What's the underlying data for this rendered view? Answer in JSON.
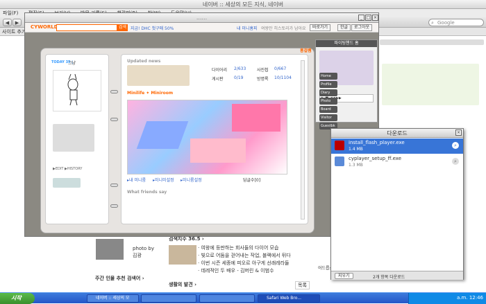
{
  "browser": {
    "title": "네이버 :: 세상의 모든 지식, 네이버",
    "menu": [
      "파일(F)",
      "편집(E)",
      "보기(V)",
      "방문 기록(S)",
      "책갈피(B)",
      "창(W)",
      "도움말(H)"
    ],
    "search_placeholder": "Google",
    "bookmark_label": "사이트 추가"
  },
  "cyworld": {
    "window_title": "......",
    "logo": "CYWORLD",
    "search_button": "검색",
    "ad_text": "지금! DHC 첫구매 50%",
    "links": [
      "내 미니홈피",
      "여왕만 히스토리가 남아요"
    ],
    "goto_label": "바로가기",
    "hangul_label": "한글",
    "logout_label": "로그아웃",
    "shop_label": "홍걸쌤",
    "left_page": {
      "today_label": "TODAY 35 |",
      "status_label": "그냥",
      "edit_history": "▶EDIT ▶HISTORY"
    },
    "right_page": {
      "updated_news": "Updated news",
      "stats": [
        {
          "label": "다이어리",
          "value": "2/633"
        },
        {
          "label": "사진첩",
          "value": "0/667"
        },
        {
          "label": "게시판",
          "value": "0/19"
        },
        {
          "label": "방명록",
          "value": "10/1104"
        }
      ],
      "minilife": "Minilife ✦ Miniroom",
      "room_links": [
        "▸내 미니룸",
        "▸미니미설정",
        "▸미니룸설정"
      ],
      "comment_label": "답글수[0]",
      "friends_say": "What friends say"
    },
    "bgm_title": "파이팅핸드 홈",
    "side_tabs": [
      "Home",
      "Profile",
      "Diary",
      "Photo",
      "Board",
      "Visitor",
      "Guestbk"
    ]
  },
  "downloads": {
    "title": "다운로드",
    "items": [
      {
        "name": "install_flash_player.exe",
        "size": "1.4 MB",
        "selected": true
      },
      {
        "name": "cyplayer_setup_ff.exe",
        "size": "1.3 MB",
        "selected": false
      }
    ],
    "clear_label": "지우기",
    "count_label": "2개 항목 다운로드"
  },
  "naver": {
    "news_title": "검색지수 36.5 ›",
    "news_items": [
      "· 여왕에 등판하는 회사들의 다이어 모습",
      "· 빛으로 어둠을 걷어내는 작업, 블랙에서 뒤다",
      "· 이번 시즌 세종에 피오르 아구게 선래레라들",
      "· 데레적인 두 배우 - 김머린 & 이범수"
    ],
    "photo_by": "photo by",
    "photo_author": "김광",
    "weekly_title": "주간 인물 추천 검색어 ›",
    "life_title": "생활의 발견 ›",
    "more_label": "목록",
    "side_caption": "어드릅스캐닝"
  },
  "taskbar": {
    "start_label": "시작",
    "tasks": [
      "네이버 :: 세상의 모",
      "",
      "",
      "Safari Web Bro..."
    ],
    "clock": "a.m. 12:46"
  }
}
